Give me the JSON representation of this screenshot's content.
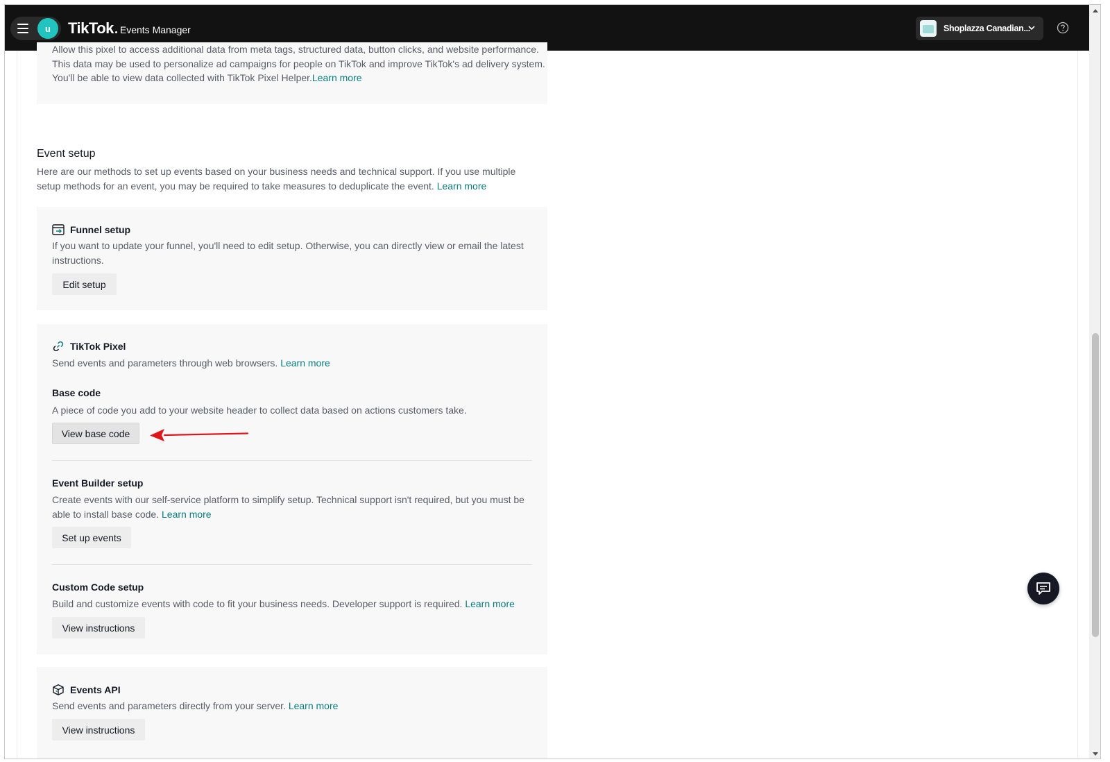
{
  "header": {
    "avatar_letter": "u",
    "brand": "TikTok",
    "product": "Events Manager",
    "account_name": "Shoplazza Canadian..."
  },
  "data_sharing": {
    "line1": "Allow this pixel to access additional data from meta tags, structured data, button clicks, and website performance.",
    "line2": "This data may be used to personalize ad campaigns for people on TikTok and improve TikTok's ad delivery system.",
    "line3": "You'll be able to view data collected with TikTok Pixel Helper.",
    "learn_more": "Learn more"
  },
  "event_setup": {
    "title": "Event setup",
    "description": "Here are our methods to set up events based on your business needs and technical support. If you use multiple setup methods for an event, you may be required to take measures to deduplicate the event. ",
    "learn_more": "Learn more"
  },
  "funnel_setup": {
    "title": "Funnel setup",
    "description": "If you want to update your funnel, you'll need to edit setup. Otherwise, you can directly view or email the latest instructions.",
    "button": "Edit setup"
  },
  "tiktok_pixel": {
    "title": "TikTok Pixel",
    "description": "Send events and parameters through web browsers. ",
    "learn_more": "Learn more",
    "base_code": {
      "title": "Base code",
      "description": "A piece of code you add to your website header to collect data based on actions customers take.",
      "button": "View base code"
    },
    "event_builder": {
      "title": "Event Builder setup",
      "description": "Create events with our self-service platform to simplify setup. Technical support isn't required, but you must be able to install base code. ",
      "learn_more": "Learn more",
      "button": "Set up events"
    },
    "custom_code": {
      "title": "Custom Code setup",
      "description": "Build and customize events with code to fit your business needs. Developer support is required. ",
      "learn_more": "Learn more",
      "button": "View instructions"
    }
  },
  "events_api": {
    "title": "Events API",
    "description": "Send events and parameters directly from your server. ",
    "learn_more": "Learn more",
    "button": "View instructions"
  },
  "colors": {
    "header_bg": "#121212",
    "accent_teal": "#0a7b7e",
    "avatar_bg": "#21c4be",
    "annotation_arrow": "#e0161b"
  }
}
